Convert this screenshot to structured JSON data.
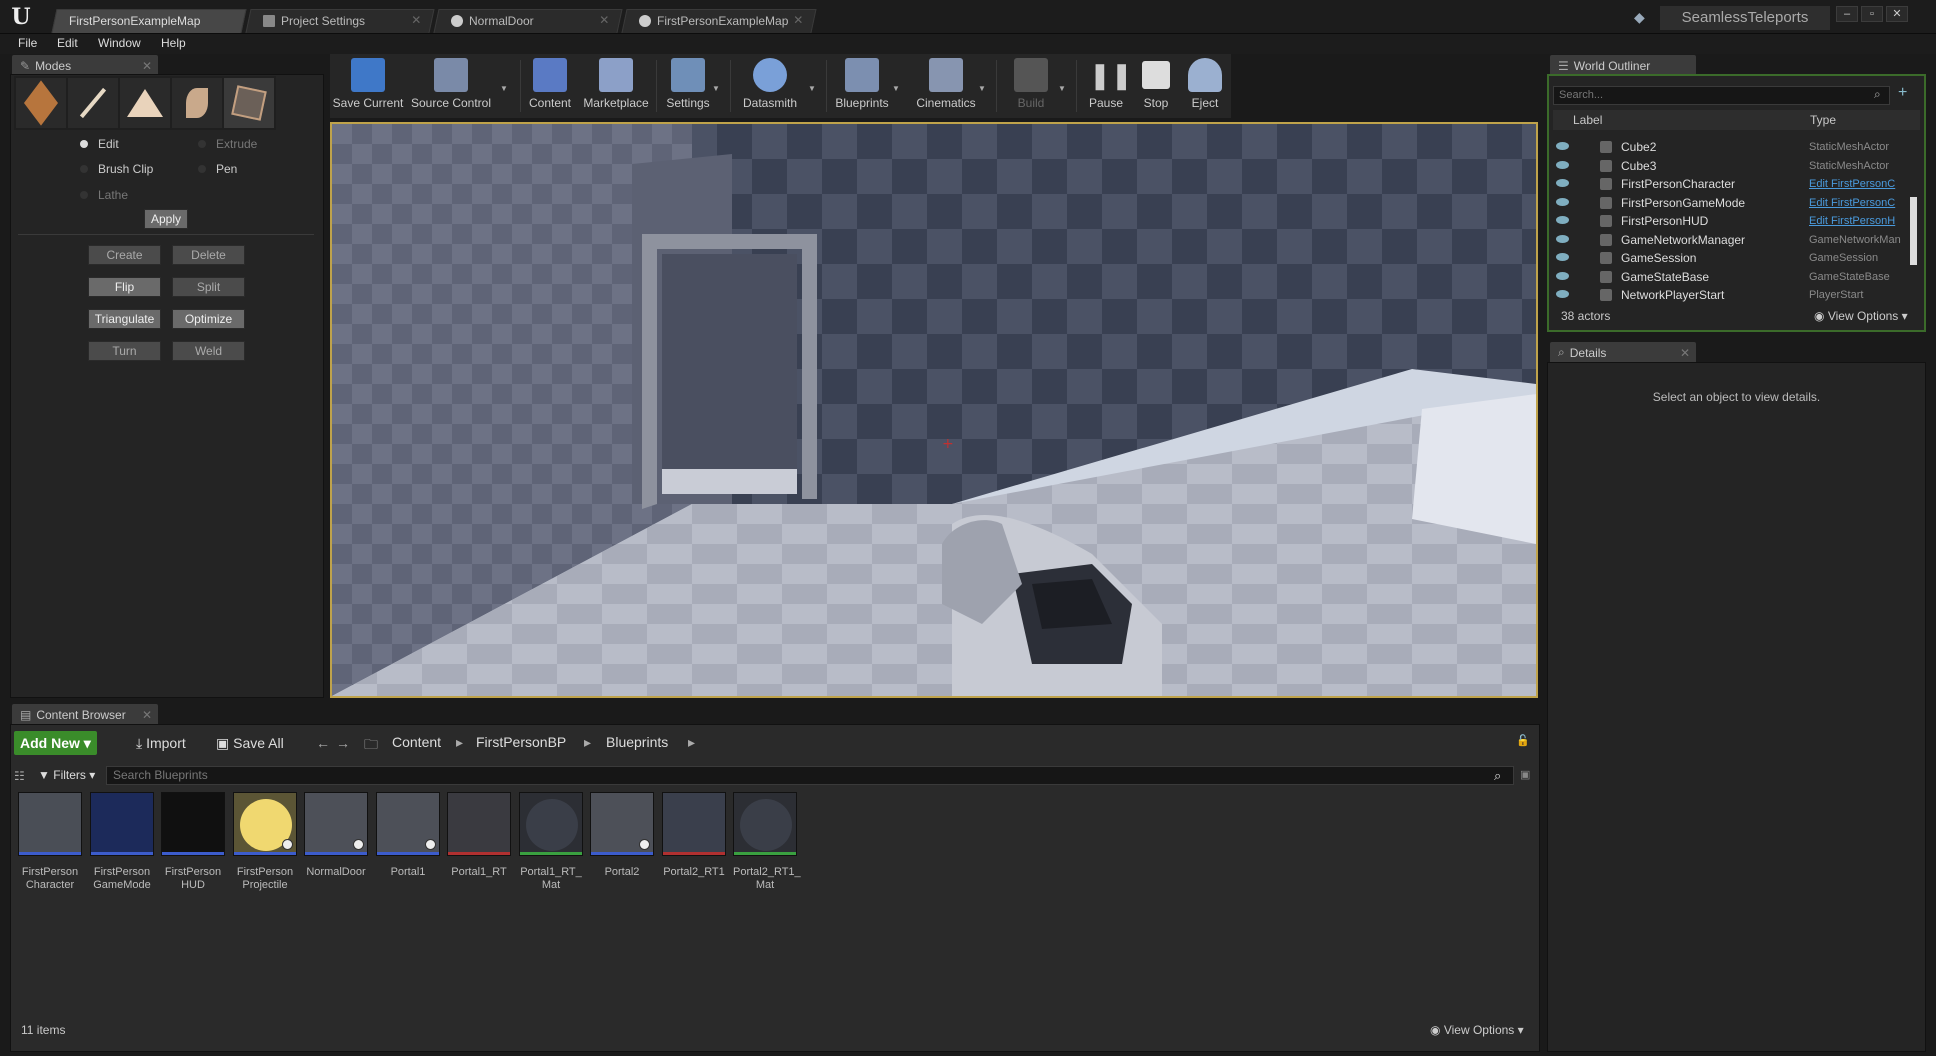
{
  "window": {
    "project_name": "SeamlessTeleports",
    "tabs": [
      {
        "label": "FirstPersonExampleMap"
      },
      {
        "label": "Project Settings"
      },
      {
        "label": "NormalDoor"
      },
      {
        "label": "FirstPersonExampleMap"
      }
    ]
  },
  "menu": [
    "File",
    "Edit",
    "Window",
    "Help"
  ],
  "modes": {
    "tab_label": "Modes",
    "radios": [
      "Edit",
      "Extrude",
      "Brush Clip",
      "Pen",
      "Lathe"
    ],
    "apply_label": "Apply",
    "buttons": [
      "Create",
      "Delete",
      "Flip",
      "Split",
      "Triangulate",
      "Optimize",
      "Turn",
      "Weld"
    ]
  },
  "toolbar": {
    "items": [
      "Save Current",
      "Source Control",
      "Content",
      "Marketplace",
      "Settings",
      "Datasmith",
      "Blueprints",
      "Cinematics",
      "Build",
      "Pause",
      "Stop",
      "Eject"
    ]
  },
  "outliner": {
    "tab_label": "World Outliner",
    "search_placeholder": "Search...",
    "col_label": "Label",
    "col_type": "Type",
    "rows": [
      {
        "label": "Cube2",
        "type": "StaticMeshActor"
      },
      {
        "label": "Cube3",
        "type": "StaticMeshActor"
      },
      {
        "label": "FirstPersonCharacter",
        "type": "Edit FirstPersonC"
      },
      {
        "label": "FirstPersonGameMode",
        "type": "Edit FirstPersonC"
      },
      {
        "label": "FirstPersonHUD",
        "type": "Edit FirstPersonH"
      },
      {
        "label": "GameNetworkManager",
        "type": "GameNetworkMan"
      },
      {
        "label": "GameSession",
        "type": "GameSession"
      },
      {
        "label": "GameStateBase",
        "type": "GameStateBase"
      },
      {
        "label": "NetworkPlayerStart",
        "type": "PlayerStart"
      }
    ],
    "actor_count": "38 actors",
    "view_options": "View Options"
  },
  "details": {
    "tab_label": "Details",
    "empty_text": "Select an object to view details."
  },
  "content_browser": {
    "tab_label": "Content Browser",
    "add_new": "Add New",
    "import": "Import",
    "save_all": "Save All",
    "path": [
      "Content",
      "FirstPersonBP",
      "Blueprints"
    ],
    "filters": "Filters",
    "search_placeholder": "Search Blueprints",
    "assets": [
      {
        "name": "FirstPerson Character",
        "bar_color": "#3c5ccc"
      },
      {
        "name": "FirstPerson GameMode",
        "bar_color": "#3c5ccc"
      },
      {
        "name": "FirstPerson HUD",
        "bar_color": "#3c5ccc"
      },
      {
        "name": "FirstPerson Projectile",
        "bar_color": "#3c5ccc"
      },
      {
        "name": "NormalDoor",
        "bar_color": "#3c5ccc"
      },
      {
        "name": "Portal1",
        "bar_color": "#3c5ccc"
      },
      {
        "name": "Portal1_RT",
        "bar_color": "#b03030"
      },
      {
        "name": "Portal1_RT_ Mat",
        "bar_color": "#3aa040"
      },
      {
        "name": "Portal2",
        "bar_color": "#3c5ccc"
      },
      {
        "name": "Portal2_RT1",
        "bar_color": "#b03030"
      },
      {
        "name": "Portal2_RT1_ Mat",
        "bar_color": "#3aa040"
      }
    ],
    "item_count": "11 items",
    "view_options": "View Options"
  }
}
